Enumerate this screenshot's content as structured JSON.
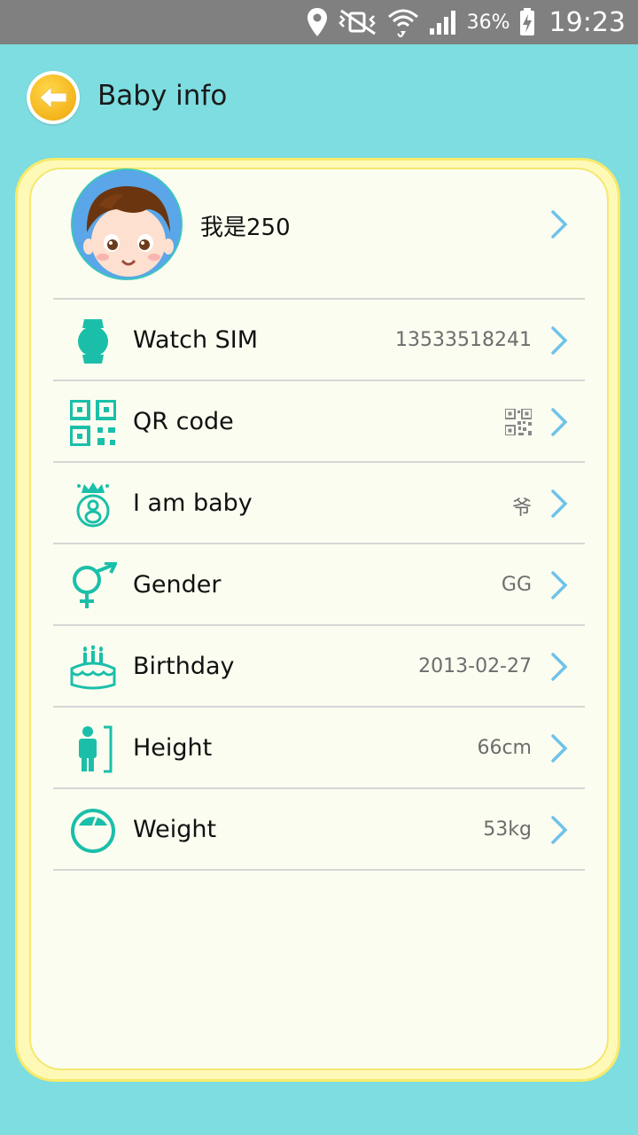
{
  "status_bar": {
    "battery_percent": "36%",
    "time": "19:23"
  },
  "header": {
    "title": "Baby info"
  },
  "profile": {
    "name": "我是250"
  },
  "rows": [
    {
      "label": "Watch SIM",
      "value": "13533518241",
      "icon": "watch-icon"
    },
    {
      "label": "QR code",
      "value": "",
      "icon": "qr-code-icon"
    },
    {
      "label": "I am baby",
      "value": "爷",
      "icon": "baby-role-icon"
    },
    {
      "label": "Gender",
      "value": "GG",
      "icon": "gender-icon"
    },
    {
      "label": "Birthday",
      "value": "2013-02-27",
      "icon": "birthday-cake-icon"
    },
    {
      "label": "Height",
      "value": "66cm",
      "icon": "height-icon"
    },
    {
      "label": "Weight",
      "value": "53kg",
      "icon": "weight-scale-icon"
    }
  ],
  "colors": {
    "background": "#7ddde0",
    "accent": "#1bbfa9",
    "chevron": "#6fc2ea",
    "card_border": "#f6ea6a"
  }
}
